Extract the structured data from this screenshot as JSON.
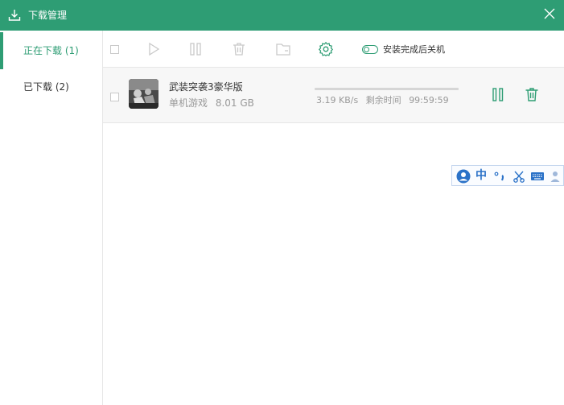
{
  "window": {
    "title": "下载管理",
    "accent_color": "#2e9d74",
    "icons": {
      "title_icon": "download-icon",
      "close": "close-icon"
    }
  },
  "sidebar": {
    "items": [
      {
        "label": "正在下载 (1)",
        "active": true
      },
      {
        "label": "已下载 (2)",
        "active": false
      }
    ]
  },
  "toolbar": {
    "icons": [
      "checkbox-icon",
      "play-icon",
      "pause-icon",
      "trash-icon",
      "folder-icon",
      "gear-icon"
    ],
    "shutdown_toggle_label": "安装完成后关机",
    "shutdown_toggle_on": false
  },
  "downloads": [
    {
      "name": "武装突袭3豪华版",
      "category": "单机游戏",
      "size": "8.01 GB",
      "speed": "3.19 KB/s",
      "remaining_label": "剩余时间",
      "remaining_time": "99:59:59",
      "progress": 0.0
    }
  ],
  "ime_toolbar": {
    "lang": "中",
    "icons": [
      "user-avatar-icon",
      "punctuation-icon",
      "scissors-icon",
      "keyboard-icon",
      "person-icon"
    ]
  }
}
